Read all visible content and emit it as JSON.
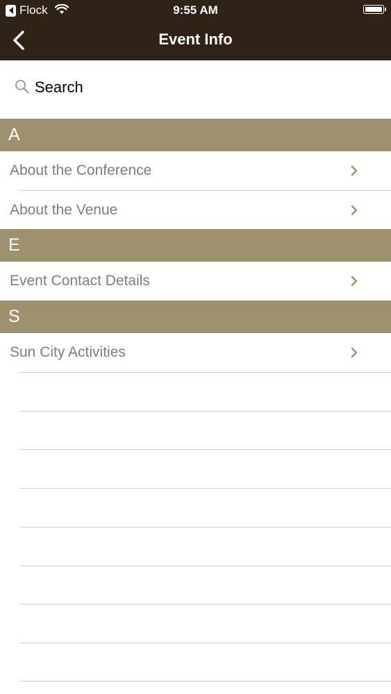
{
  "status_bar": {
    "back_app": "Flock",
    "time": "9:55 AM"
  },
  "nav": {
    "title": "Event Info"
  },
  "search": {
    "placeholder": "Search"
  },
  "sections": [
    {
      "letter": "A",
      "items": [
        "About the Conference",
        "About the Venue"
      ]
    },
    {
      "letter": "E",
      "items": [
        "Event Contact Details"
      ]
    },
    {
      "letter": "S",
      "items": [
        "Sun City Activities"
      ]
    }
  ],
  "colors": {
    "nav_background": "#2f2318",
    "section_header": "#9e916e",
    "item_text": "#7d7d7d",
    "chevron": "#9e916e"
  },
  "icons": {
    "back": "chevron-left-icon",
    "search": "magnifier-icon",
    "row": "chevron-right-icon"
  }
}
